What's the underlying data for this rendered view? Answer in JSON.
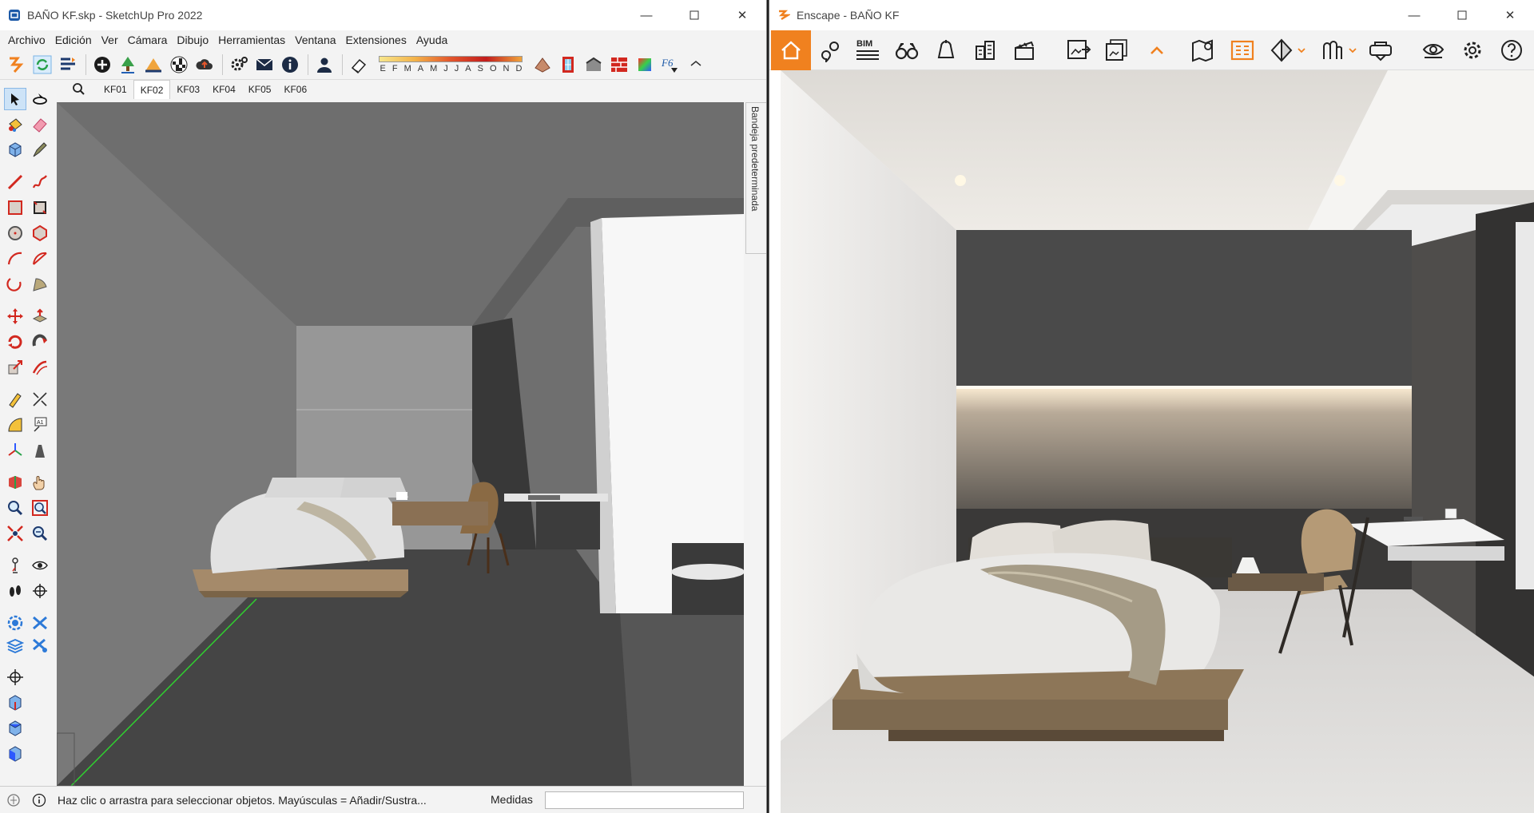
{
  "sketchup": {
    "title": "BAÑO KF.skp - SketchUp Pro 2022",
    "menu": [
      "Archivo",
      "Edición",
      "Ver",
      "Cámara",
      "Dibujo",
      "Herramientas",
      "Ventana",
      "Extensiones",
      "Ayuda"
    ],
    "months": [
      "E",
      "F",
      "M",
      "A",
      "M",
      "J",
      "J",
      "A",
      "S",
      "O",
      "N",
      "D"
    ],
    "scenes": [
      "KF01",
      "KF02",
      "KF03",
      "KF04",
      "KF05",
      "KF06"
    ],
    "active_scene": "KF02",
    "tray_label": "Bandeja predeterminada",
    "status_text": "Haz clic o arrastra para seleccionar objetos. Mayúsculas = Añadir/Sustra...",
    "measures_label": "Medidas",
    "measures_value": ""
  },
  "enscape": {
    "title": "Enscape - BAÑO KF",
    "bim_label": "BIM"
  },
  "colors": {
    "enscape_orange": "#f0811f",
    "sketchup_red": "#d2281f",
    "sketchup_blue": "#1d5aa8"
  }
}
